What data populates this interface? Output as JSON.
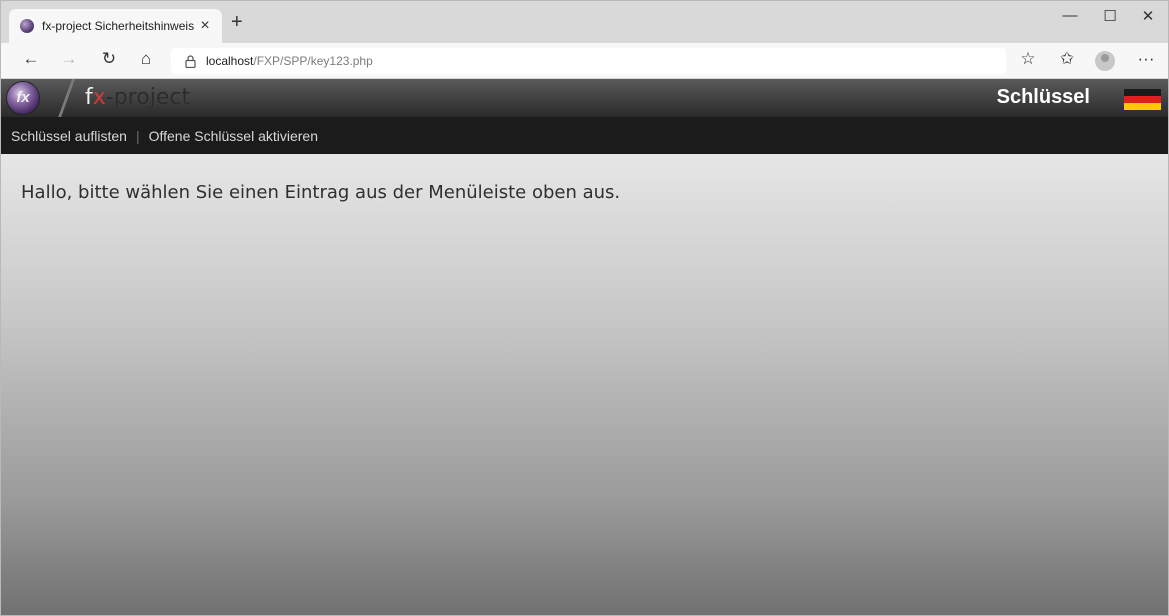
{
  "browser": {
    "tab": {
      "title": "fx-project Sicherheitshinweis",
      "close_glyph": "×"
    },
    "new_tab_glyph": "+",
    "window_controls": {
      "minimize": "—",
      "maximize": "☐",
      "close": "✕"
    },
    "toolbar": {
      "back": "←",
      "forward": "→",
      "reload": "↻",
      "home": "⌂",
      "url_host": "localhost",
      "url_path": "/FXP/SPP/key123.php",
      "favorites_add": "☆",
      "favorites": "✩",
      "more": "···"
    },
    "icons": {
      "tab_favicon": "fx-project-favicon",
      "lock": "lock-icon",
      "profile": "profile-icon"
    }
  },
  "site": {
    "logo_text": "fx",
    "brand": {
      "f": "f",
      "x": "x",
      "rest": "-project"
    },
    "section_title": "Schlüssel",
    "flag": "german-flag",
    "nav": {
      "items": [
        {
          "label": "Schlüssel auflisten"
        },
        {
          "label": "Offene Schlüssel aktivieren"
        }
      ],
      "separator": "|"
    },
    "message": "Hallo, bitte wählen Sie einen Eintrag aus der Menüleiste oben aus.",
    "colors": {
      "header_dark": "#2a2a2a",
      "nav_bg": "#1b1b1b",
      "brand_x": "#d23a3a",
      "flag_black": "#1a1a1a",
      "flag_red": "#e01e1e",
      "flag_gold": "#ffc800"
    }
  }
}
